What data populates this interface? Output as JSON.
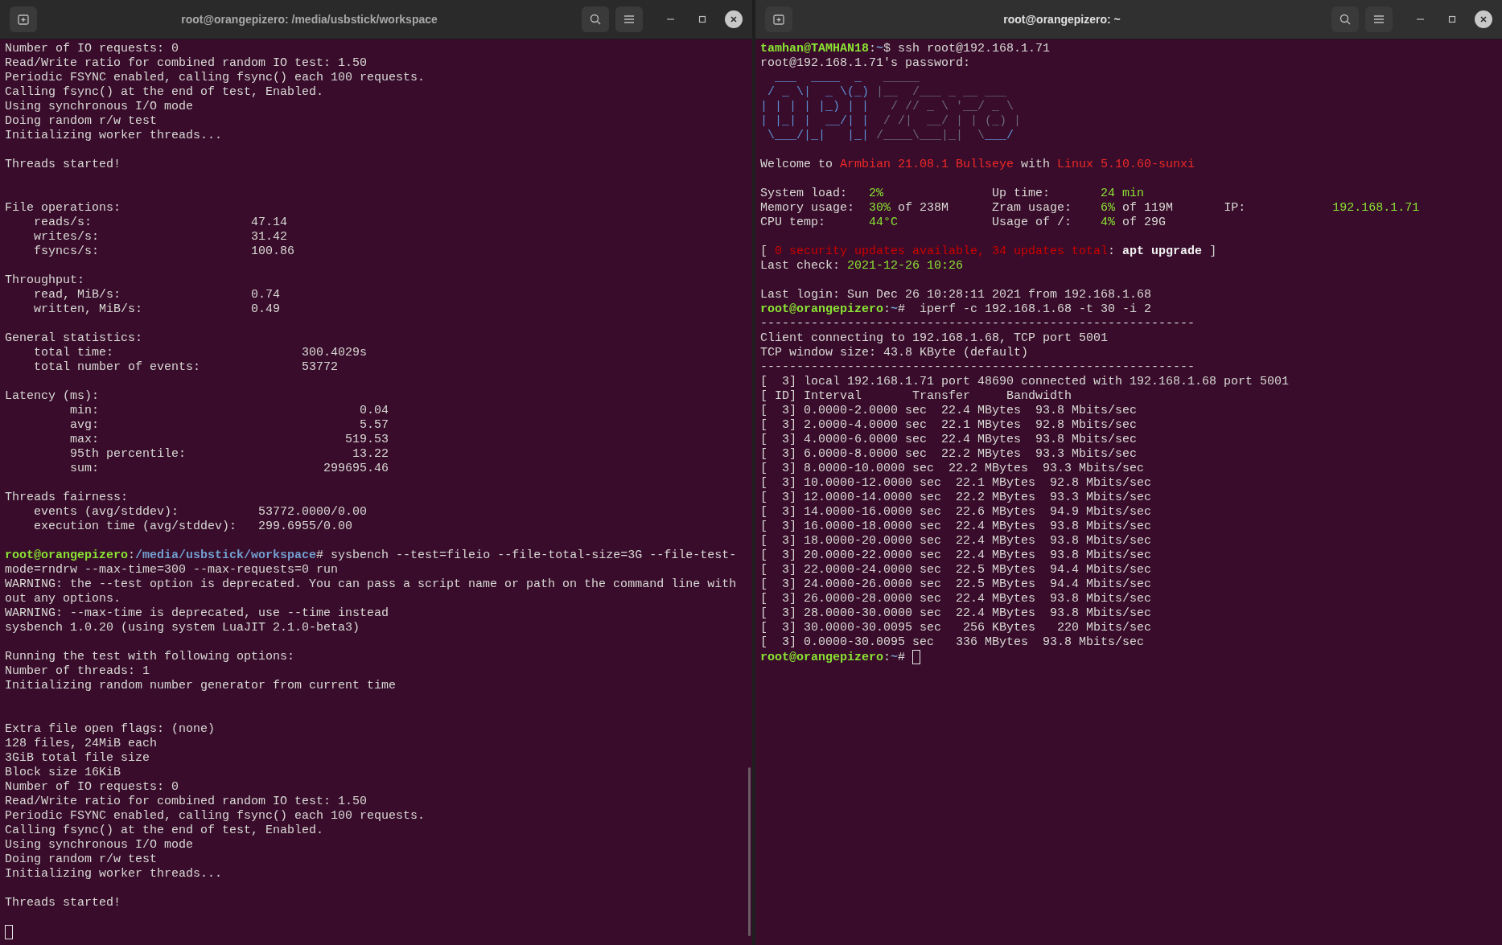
{
  "terminals": [
    {
      "title": "root@orangepizero: /media/usbstick/workspace",
      "focused": false,
      "lines": [
        {
          "kind": "text",
          "spans": [
            {
              "kind": "plain",
              "text": "Number of IO requests: 0"
            }
          ]
        },
        {
          "kind": "text",
          "spans": [
            {
              "kind": "plain",
              "text": "Read/Write ratio for combined random IO test: 1.50"
            }
          ]
        },
        {
          "kind": "text",
          "spans": [
            {
              "kind": "plain",
              "text": "Periodic FSYNC enabled, calling fsync() each 100 requests."
            }
          ]
        },
        {
          "kind": "text",
          "spans": [
            {
              "kind": "plain",
              "text": "Calling fsync() at the end of test, Enabled."
            }
          ]
        },
        {
          "kind": "text",
          "spans": [
            {
              "kind": "plain",
              "text": "Using synchronous I/O mode"
            }
          ]
        },
        {
          "kind": "text",
          "spans": [
            {
              "kind": "plain",
              "text": "Doing random r/w test"
            }
          ]
        },
        {
          "kind": "text",
          "spans": [
            {
              "kind": "plain",
              "text": "Initializing worker threads..."
            }
          ]
        },
        {
          "kind": "blank"
        },
        {
          "kind": "text",
          "spans": [
            {
              "kind": "plain",
              "text": "Threads started!"
            }
          ]
        },
        {
          "kind": "blank"
        },
        {
          "kind": "blank"
        },
        {
          "kind": "text",
          "spans": [
            {
              "kind": "plain",
              "text": "File operations:"
            }
          ]
        },
        {
          "kind": "text",
          "spans": [
            {
              "kind": "plain",
              "text": "    reads/s:                      47.14"
            }
          ]
        },
        {
          "kind": "text",
          "spans": [
            {
              "kind": "plain",
              "text": "    writes/s:                     31.42"
            }
          ]
        },
        {
          "kind": "text",
          "spans": [
            {
              "kind": "plain",
              "text": "    fsyncs/s:                     100.86"
            }
          ]
        },
        {
          "kind": "blank"
        },
        {
          "kind": "text",
          "spans": [
            {
              "kind": "plain",
              "text": "Throughput:"
            }
          ]
        },
        {
          "kind": "text",
          "spans": [
            {
              "kind": "plain",
              "text": "    read, MiB/s:                  0.74"
            }
          ]
        },
        {
          "kind": "text",
          "spans": [
            {
              "kind": "plain",
              "text": "    written, MiB/s:               0.49"
            }
          ]
        },
        {
          "kind": "blank"
        },
        {
          "kind": "text",
          "spans": [
            {
              "kind": "plain",
              "text": "General statistics:"
            }
          ]
        },
        {
          "kind": "text",
          "spans": [
            {
              "kind": "plain",
              "text": "    total time:                          300.4029s"
            }
          ]
        },
        {
          "kind": "text",
          "spans": [
            {
              "kind": "plain",
              "text": "    total number of events:              53772"
            }
          ]
        },
        {
          "kind": "blank"
        },
        {
          "kind": "text",
          "spans": [
            {
              "kind": "plain",
              "text": "Latency (ms):"
            }
          ]
        },
        {
          "kind": "text",
          "spans": [
            {
              "kind": "plain",
              "text": "         min:                                    0.04"
            }
          ]
        },
        {
          "kind": "text",
          "spans": [
            {
              "kind": "plain",
              "text": "         avg:                                    5.57"
            }
          ]
        },
        {
          "kind": "text",
          "spans": [
            {
              "kind": "plain",
              "text": "         max:                                  519.53"
            }
          ]
        },
        {
          "kind": "text",
          "spans": [
            {
              "kind": "plain",
              "text": "         95th percentile:                       13.22"
            }
          ]
        },
        {
          "kind": "text",
          "spans": [
            {
              "kind": "plain",
              "text": "         sum:                               299695.46"
            }
          ]
        },
        {
          "kind": "blank"
        },
        {
          "kind": "text",
          "spans": [
            {
              "kind": "plain",
              "text": "Threads fairness:"
            }
          ]
        },
        {
          "kind": "text",
          "spans": [
            {
              "kind": "plain",
              "text": "    events (avg/stddev):           53772.0000/0.00"
            }
          ]
        },
        {
          "kind": "text",
          "spans": [
            {
              "kind": "plain",
              "text": "    execution time (avg/stddev):   299.6955/0.00"
            }
          ]
        },
        {
          "kind": "blank"
        },
        {
          "kind": "text",
          "spans": [
            {
              "kind": "prompt",
              "text": "root@orangepizero"
            },
            {
              "kind": "plain",
              "text": ":"
            },
            {
              "kind": "path",
              "text": "/media/usbstick/workspace"
            },
            {
              "kind": "plain",
              "text": "# sysbench --test=fileio --file-total-size=3G --file-test-"
            }
          ]
        },
        {
          "kind": "text",
          "spans": [
            {
              "kind": "plain",
              "text": "mode=rndrw --max-time=300 --max-requests=0 run"
            }
          ]
        },
        {
          "kind": "text",
          "spans": [
            {
              "kind": "plain",
              "text": "WARNING: the --test option is deprecated. You can pass a script name or path on the command line with"
            }
          ]
        },
        {
          "kind": "text",
          "spans": [
            {
              "kind": "plain",
              "text": "out any options."
            }
          ]
        },
        {
          "kind": "text",
          "spans": [
            {
              "kind": "plain",
              "text": "WARNING: --max-time is deprecated, use --time instead"
            }
          ]
        },
        {
          "kind": "text",
          "spans": [
            {
              "kind": "plain",
              "text": "sysbench 1.0.20 (using system LuaJIT 2.1.0-beta3)"
            }
          ]
        },
        {
          "kind": "blank"
        },
        {
          "kind": "text",
          "spans": [
            {
              "kind": "plain",
              "text": "Running the test with following options:"
            }
          ]
        },
        {
          "kind": "text",
          "spans": [
            {
              "kind": "plain",
              "text": "Number of threads: 1"
            }
          ]
        },
        {
          "kind": "text",
          "spans": [
            {
              "kind": "plain",
              "text": "Initializing random number generator from current time"
            }
          ]
        },
        {
          "kind": "blank"
        },
        {
          "kind": "blank"
        },
        {
          "kind": "text",
          "spans": [
            {
              "kind": "plain",
              "text": "Extra file open flags: (none)"
            }
          ]
        },
        {
          "kind": "text",
          "spans": [
            {
              "kind": "plain",
              "text": "128 files, 24MiB each"
            }
          ]
        },
        {
          "kind": "text",
          "spans": [
            {
              "kind": "plain",
              "text": "3GiB total file size"
            }
          ]
        },
        {
          "kind": "text",
          "spans": [
            {
              "kind": "plain",
              "text": "Block size 16KiB"
            }
          ]
        },
        {
          "kind": "text",
          "spans": [
            {
              "kind": "plain",
              "text": "Number of IO requests: 0"
            }
          ]
        },
        {
          "kind": "text",
          "spans": [
            {
              "kind": "plain",
              "text": "Read/Write ratio for combined random IO test: 1.50"
            }
          ]
        },
        {
          "kind": "text",
          "spans": [
            {
              "kind": "plain",
              "text": "Periodic FSYNC enabled, calling fsync() each 100 requests."
            }
          ]
        },
        {
          "kind": "text",
          "spans": [
            {
              "kind": "plain",
              "text": "Calling fsync() at the end of test, Enabled."
            }
          ]
        },
        {
          "kind": "text",
          "spans": [
            {
              "kind": "plain",
              "text": "Using synchronous I/O mode"
            }
          ]
        },
        {
          "kind": "text",
          "spans": [
            {
              "kind": "plain",
              "text": "Doing random r/w test"
            }
          ]
        },
        {
          "kind": "text",
          "spans": [
            {
              "kind": "plain",
              "text": "Initializing worker threads..."
            }
          ]
        },
        {
          "kind": "blank"
        },
        {
          "kind": "text",
          "spans": [
            {
              "kind": "plain",
              "text": "Threads started!"
            }
          ]
        },
        {
          "kind": "blank"
        },
        {
          "kind": "cursor"
        }
      ]
    },
    {
      "title": "root@orangepizero: ~",
      "focused": true,
      "lines": [
        {
          "kind": "text",
          "spans": [
            {
              "kind": "prompt",
              "text": "tamhan@TAMHAN18"
            },
            {
              "kind": "plain",
              "text": ":"
            },
            {
              "kind": "path",
              "text": "~"
            },
            {
              "kind": "plain",
              "text": "$ ssh root@192.168.1.71"
            }
          ]
        },
        {
          "kind": "text",
          "spans": [
            {
              "kind": "plain",
              "text": "root@192.168.1.71's password:"
            }
          ]
        },
        {
          "kind": "text",
          "spans": [
            {
              "kind": "art-blue",
              "text": "  ___  ____  _   "
            },
            {
              "kind": "art-grey",
              "text": "_____"
            }
          ]
        },
        {
          "kind": "text",
          "spans": [
            {
              "kind": "art-blue",
              "text": " / _ \\|  _ \\(_) "
            },
            {
              "kind": "art-grey",
              "text": "|__  /___ _ __ ___"
            }
          ]
        },
        {
          "kind": "text",
          "spans": [
            {
              "kind": "art-blue",
              "text": "| | | | |_) | |   "
            },
            {
              "kind": "art-grey",
              "text": "/ // _ \\ '__/ _ \\"
            }
          ]
        },
        {
          "kind": "text",
          "spans": [
            {
              "kind": "art-blue",
              "text": "| |_| |  __/| |  "
            },
            {
              "kind": "art-grey",
              "text": "/ /|  __/ | | (_) |"
            }
          ]
        },
        {
          "kind": "text",
          "spans": [
            {
              "kind": "art-blue",
              "text": " \\___/|_|   |_| "
            },
            {
              "kind": "art-grey",
              "text": "/____\\___|_|  \\"
            },
            {
              "kind": "art-blue",
              "text": "___/"
            }
          ]
        },
        {
          "kind": "blank"
        },
        {
          "kind": "text",
          "spans": [
            {
              "kind": "plain",
              "text": "Welcome to "
            },
            {
              "kind": "red",
              "text": "Armbian 21.08.1 Bullseye"
            },
            {
              "kind": "plain",
              "text": " with "
            },
            {
              "kind": "red",
              "text": "Linux 5.10.60-sunxi"
            }
          ]
        },
        {
          "kind": "blank"
        },
        {
          "kind": "text",
          "spans": [
            {
              "kind": "plain",
              "text": "System load:   "
            },
            {
              "kind": "value",
              "text": "2%"
            },
            {
              "kind": "plain",
              "text": "               Up time:       "
            },
            {
              "kind": "value",
              "text": "24 min"
            }
          ]
        },
        {
          "kind": "text",
          "spans": [
            {
              "kind": "plain",
              "text": "Memory usage:  "
            },
            {
              "kind": "value",
              "text": "30%"
            },
            {
              "kind": "plain",
              "text": " of 238M      Zram usage:    "
            },
            {
              "kind": "value",
              "text": "6%"
            },
            {
              "kind": "plain",
              "text": " of 119M       IP:            "
            },
            {
              "kind": "value",
              "text": "192.168.1.71"
            }
          ]
        },
        {
          "kind": "text",
          "spans": [
            {
              "kind": "plain",
              "text": "CPU temp:      "
            },
            {
              "kind": "value",
              "text": "44°C"
            },
            {
              "kind": "plain",
              "text": "             Usage of /:    "
            },
            {
              "kind": "value",
              "text": "4%"
            },
            {
              "kind": "plain",
              "text": " of 29G"
            }
          ]
        },
        {
          "kind": "blank"
        },
        {
          "kind": "text",
          "spans": [
            {
              "kind": "plain",
              "text": "[ "
            },
            {
              "kind": "dark-red",
              "text": "0 security updates available, 34 updates total"
            },
            {
              "kind": "plain",
              "text": ": "
            },
            {
              "kind": "bold",
              "text": "apt upgrade"
            },
            {
              "kind": "plain",
              "text": " ]"
            }
          ]
        },
        {
          "kind": "text",
          "spans": [
            {
              "kind": "plain",
              "text": "Last check: "
            },
            {
              "kind": "value",
              "text": "2021-12-26 10:26"
            }
          ]
        },
        {
          "kind": "blank"
        },
        {
          "kind": "text",
          "spans": [
            {
              "kind": "plain",
              "text": "Last login: Sun Dec 26 10:28:11 2021 from 192.168.1.68"
            }
          ]
        },
        {
          "kind": "text",
          "spans": [
            {
              "kind": "prompt",
              "text": "root@orangepizero"
            },
            {
              "kind": "plain",
              "text": ":"
            },
            {
              "kind": "path",
              "text": "~"
            },
            {
              "kind": "plain",
              "text": "#  iperf -c 192.168.1.68 -t 30 -i 2"
            }
          ]
        },
        {
          "kind": "text",
          "spans": [
            {
              "kind": "plain",
              "text": "------------------------------------------------------------"
            }
          ]
        },
        {
          "kind": "text",
          "spans": [
            {
              "kind": "plain",
              "text": "Client connecting to 192.168.1.68, TCP port 5001"
            }
          ]
        },
        {
          "kind": "text",
          "spans": [
            {
              "kind": "plain",
              "text": "TCP window size: 43.8 KByte (default)"
            }
          ]
        },
        {
          "kind": "text",
          "spans": [
            {
              "kind": "plain",
              "text": "------------------------------------------------------------"
            }
          ]
        },
        {
          "kind": "text",
          "spans": [
            {
              "kind": "plain",
              "text": "[  3] local 192.168.1.71 port 48690 connected with 192.168.1.68 port 5001"
            }
          ]
        },
        {
          "kind": "text",
          "spans": [
            {
              "kind": "plain",
              "text": "[ ID] Interval       Transfer     Bandwidth"
            }
          ]
        },
        {
          "kind": "text",
          "spans": [
            {
              "kind": "plain",
              "text": "[  3] 0.0000-2.0000 sec  22.4 MBytes  93.8 Mbits/sec"
            }
          ]
        },
        {
          "kind": "text",
          "spans": [
            {
              "kind": "plain",
              "text": "[  3] 2.0000-4.0000 sec  22.1 MBytes  92.8 Mbits/sec"
            }
          ]
        },
        {
          "kind": "text",
          "spans": [
            {
              "kind": "plain",
              "text": "[  3] 4.0000-6.0000 sec  22.4 MBytes  93.8 Mbits/sec"
            }
          ]
        },
        {
          "kind": "text",
          "spans": [
            {
              "kind": "plain",
              "text": "[  3] 6.0000-8.0000 sec  22.2 MBytes  93.3 Mbits/sec"
            }
          ]
        },
        {
          "kind": "text",
          "spans": [
            {
              "kind": "plain",
              "text": "[  3] 8.0000-10.0000 sec  22.2 MBytes  93.3 Mbits/sec"
            }
          ]
        },
        {
          "kind": "text",
          "spans": [
            {
              "kind": "plain",
              "text": "[  3] 10.0000-12.0000 sec  22.1 MBytes  92.8 Mbits/sec"
            }
          ]
        },
        {
          "kind": "text",
          "spans": [
            {
              "kind": "plain",
              "text": "[  3] 12.0000-14.0000 sec  22.2 MBytes  93.3 Mbits/sec"
            }
          ]
        },
        {
          "kind": "text",
          "spans": [
            {
              "kind": "plain",
              "text": "[  3] 14.0000-16.0000 sec  22.6 MBytes  94.9 Mbits/sec"
            }
          ]
        },
        {
          "kind": "text",
          "spans": [
            {
              "kind": "plain",
              "text": "[  3] 16.0000-18.0000 sec  22.4 MBytes  93.8 Mbits/sec"
            }
          ]
        },
        {
          "kind": "text",
          "spans": [
            {
              "kind": "plain",
              "text": "[  3] 18.0000-20.0000 sec  22.4 MBytes  93.8 Mbits/sec"
            }
          ]
        },
        {
          "kind": "text",
          "spans": [
            {
              "kind": "plain",
              "text": "[  3] 20.0000-22.0000 sec  22.4 MBytes  93.8 Mbits/sec"
            }
          ]
        },
        {
          "kind": "text",
          "spans": [
            {
              "kind": "plain",
              "text": "[  3] 22.0000-24.0000 sec  22.5 MBytes  94.4 Mbits/sec"
            }
          ]
        },
        {
          "kind": "text",
          "spans": [
            {
              "kind": "plain",
              "text": "[  3] 24.0000-26.0000 sec  22.5 MBytes  94.4 Mbits/sec"
            }
          ]
        },
        {
          "kind": "text",
          "spans": [
            {
              "kind": "plain",
              "text": "[  3] 26.0000-28.0000 sec  22.4 MBytes  93.8 Mbits/sec"
            }
          ]
        },
        {
          "kind": "text",
          "spans": [
            {
              "kind": "plain",
              "text": "[  3] 28.0000-30.0000 sec  22.4 MBytes  93.8 Mbits/sec"
            }
          ]
        },
        {
          "kind": "text",
          "spans": [
            {
              "kind": "plain",
              "text": "[  3] 30.0000-30.0095 sec   256 KBytes   220 Mbits/sec"
            }
          ]
        },
        {
          "kind": "text",
          "spans": [
            {
              "kind": "plain",
              "text": "[  3] 0.0000-30.0095 sec   336 MBytes  93.8 Mbits/sec"
            }
          ]
        },
        {
          "kind": "text",
          "spans": [
            {
              "kind": "prompt",
              "text": "root@orangepizero"
            },
            {
              "kind": "plain",
              "text": ":"
            },
            {
              "kind": "path",
              "text": "~"
            },
            {
              "kind": "plain",
              "text": "# "
            },
            {
              "kind": "cursor"
            }
          ]
        }
      ]
    }
  ]
}
